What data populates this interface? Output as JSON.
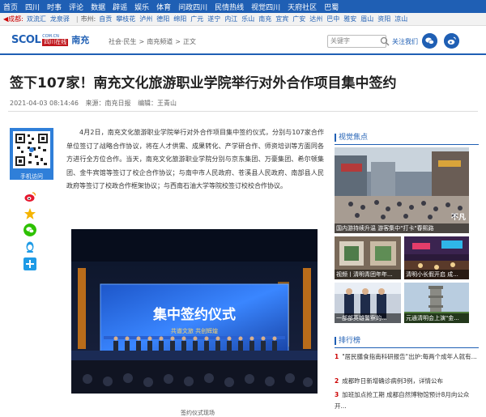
{
  "topnav": [
    "首页",
    "四川",
    "时事",
    "评论",
    "数据",
    "辟谣",
    "娱乐",
    "体育",
    "问政四川",
    "民情热线",
    "视觉四川",
    "天府社区",
    "巴蜀"
  ],
  "citybar": {
    "location": "◀成都:",
    "links1": [
      "双流汇",
      "龙泉驿"
    ],
    "label": "市州:",
    "cities": [
      "自贡",
      "攀枝花",
      "泸州",
      "德阳",
      "绵阳",
      "广元",
      "遂宁",
      "内江",
      "乐山",
      "南充",
      "宜宾",
      "广安",
      "达州",
      "巴中",
      "雅安",
      "眉山",
      "资阳",
      "凉山"
    ]
  },
  "logo": {
    "scol": "SCOL",
    "domain": "COM.CN",
    "cn": "四川在线",
    "channel": "南充"
  },
  "breadcrumb": [
    "社会·民生",
    "南充频道",
    "正文"
  ],
  "search": {
    "placeholder": "关键字"
  },
  "follow_label": "关注我们",
  "article": {
    "title": "签下107家！南充文化旅游职业学院举行对外合作项目集中签约",
    "date": "2021-04-03 08:14:46",
    "source": "来源：南充日报",
    "editor": "编辑：王青山",
    "body": "4月2日，南充文化旅游职业学院举行对外合作项目集中签约仪式，分别与107家合作单位签订了战略合作协议，将在人才供需、成果转化、产学研合作、师资培训等方面同各方进行全方位合作。当天，南充文化旅游职业学院分别与京东集团、万豪集团、希尔顿集团、金牛宾馆等签订了校企合作协议；与南中市人民政府、苍溪县人民政府、南部县人民政府等签订了校政合作框架协议；与西南石油大学等院校签订校校合作协议。",
    "photo_banner": "集中签约仪式",
    "photo_sub": "共谱文旅  共创辉煌",
    "caption": "签约仪式现场"
  },
  "qr_label": "手机访问",
  "visual": {
    "title": "视觉焦点",
    "items": [
      {
        "cap": "国内游持续升温 游客集中\"打卡\"春熙路"
      },
      {
        "cap": "视频丨清明青团年年..."
      },
      {
        "cap": "清明小长假开启 成..."
      },
      {
        "cap": "一部部英雄警察的..."
      },
      {
        "cap": "元通清明会上演\"金..."
      }
    ],
    "watermark": "不凡"
  },
  "ranking": {
    "title": "排行榜",
    "items": [
      {
        "n": "1",
        "text": "\"居民膳食指南科研报告\"出炉:每两个成年人就有..."
      },
      {
        "n": "2",
        "text": "成都昨日新增确诊病例3例，详情公布"
      },
      {
        "n": "3",
        "text": "加班加点抢工期 成都自然博物馆预计8月向公众开..."
      }
    ]
  },
  "colors": {
    "brand": "#1f5fb4",
    "accent_red": "#c0161d"
  }
}
